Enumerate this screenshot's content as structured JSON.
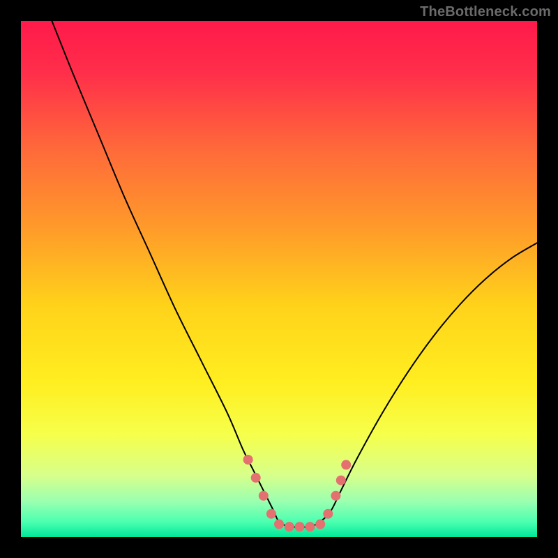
{
  "watermark": "TheBottleneck.com",
  "chart_data": {
    "type": "line",
    "title": "",
    "xlabel": "",
    "ylabel": "",
    "xlim": [
      0,
      100
    ],
    "ylim": [
      0,
      100
    ],
    "legend": false,
    "grid": false,
    "background_gradient_stops": [
      {
        "offset": 0.0,
        "color": "#ff1a4b"
      },
      {
        "offset": 0.1,
        "color": "#ff2e4a"
      },
      {
        "offset": 0.25,
        "color": "#ff6a3a"
      },
      {
        "offset": 0.4,
        "color": "#ff9a2a"
      },
      {
        "offset": 0.55,
        "color": "#ffd21a"
      },
      {
        "offset": 0.7,
        "color": "#ffee20"
      },
      {
        "offset": 0.8,
        "color": "#f6ff4a"
      },
      {
        "offset": 0.88,
        "color": "#d8ff8a"
      },
      {
        "offset": 0.93,
        "color": "#9cffb0"
      },
      {
        "offset": 0.97,
        "color": "#4dffb0"
      },
      {
        "offset": 1.0,
        "color": "#00e89a"
      }
    ],
    "series": [
      {
        "name": "bottleneck-curve",
        "color": "#000000",
        "stroke_width": 2,
        "x": [
          6,
          10,
          15,
          20,
          25,
          30,
          35,
          40,
          43,
          45,
          47,
          49,
          50,
          52,
          54,
          56,
          58,
          60,
          62,
          65,
          70,
          75,
          80,
          85,
          90,
          95,
          100
        ],
        "values": [
          100,
          90,
          78,
          66,
          55,
          44,
          34,
          24,
          17,
          13,
          9,
          5,
          3,
          2,
          2,
          2,
          3,
          5,
          9,
          15,
          24,
          32,
          39,
          45,
          50,
          54,
          57
        ]
      }
    ],
    "markers": {
      "name": "bottleneck-markers",
      "color": "#e4706f",
      "radius": 7,
      "points": [
        {
          "x": 44.0,
          "y": 15.0
        },
        {
          "x": 45.5,
          "y": 11.5
        },
        {
          "x": 47.0,
          "y": 8.0
        },
        {
          "x": 48.5,
          "y": 4.5
        },
        {
          "x": 50.0,
          "y": 2.5
        },
        {
          "x": 52.0,
          "y": 2.0
        },
        {
          "x": 54.0,
          "y": 2.0
        },
        {
          "x": 56.0,
          "y": 2.0
        },
        {
          "x": 58.0,
          "y": 2.5
        },
        {
          "x": 59.5,
          "y": 4.5
        },
        {
          "x": 61.0,
          "y": 8.0
        },
        {
          "x": 62.0,
          "y": 11.0
        },
        {
          "x": 63.0,
          "y": 14.0
        }
      ]
    }
  }
}
